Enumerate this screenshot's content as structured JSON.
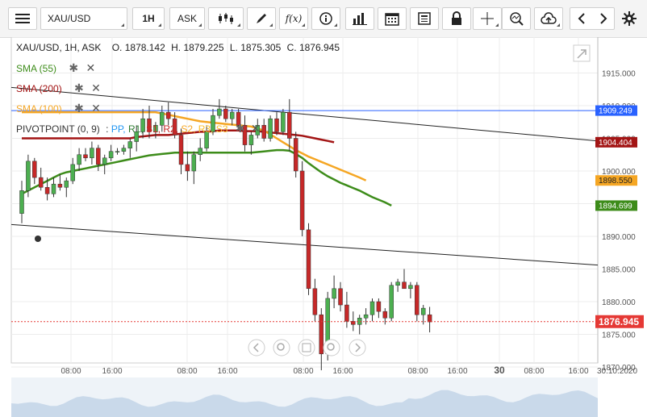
{
  "toolbar": {
    "symbol": "XAU/USD",
    "interval": "1H",
    "price_type": "ASK",
    "icons": [
      "menu-icon",
      "candlestick-type-icon",
      "draw-pen-icon",
      "function-icon",
      "info-icon",
      "volume-bars-icon",
      "calendar-icon",
      "news-icon",
      "lock-icon",
      "crosshair-icon",
      "zoom-icon",
      "cloud-upload-icon",
      "back-arrow-icon",
      "forward-arrow-icon",
      "settings-gear-icon"
    ]
  },
  "header": {
    "instrument": "XAU/USD, 1H, ASK",
    "open": "O. 1878.142",
    "high": "H. 1879.225",
    "low": "L. 1875.305",
    "close": "C. 1876.945"
  },
  "indicators": {
    "sma55": "SMA (55)",
    "sma200": "SMA (200)",
    "sma100": "SMA (100)",
    "pivot_name": "PIVOTPOINT (0, 9)",
    "pivot_sep": ":",
    "pivot_levels": [
      "PP,",
      "R1,",
      "S1,",
      "R2,",
      "S2,",
      "R3,",
      "S3"
    ]
  },
  "colors": {
    "up": "#4caf50",
    "down": "#c62828",
    "sma55": "#3d8c1a",
    "sma200": "#a31515",
    "sma100": "#f5a623",
    "current_price": "#e53935",
    "hline": "#2962ff"
  },
  "chart_data": {
    "type": "candlestick",
    "y_axis": {
      "ylim": [
        1866.0,
        1915.5
      ],
      "ticks": [
        "1915.000",
        "1910.000",
        "1905.000",
        "1900.000",
        "1895.000",
        "1890.000",
        "1885.000",
        "1880.000",
        "1875.000",
        "1870.000"
      ]
    },
    "x_axis": {
      "ticks": [
        "08:00",
        "16:00",
        "08:00",
        "16:00",
        "08:00",
        "16:00",
        "08:00",
        "16:00",
        "30",
        "08:00",
        "16:00",
        "30.10.2020"
      ]
    },
    "price_labels": [
      {
        "name": "horizontal-line",
        "value": "1909.249"
      },
      {
        "name": "sma200",
        "value": "1904.404"
      },
      {
        "name": "sma100",
        "value": "1898.550"
      },
      {
        "name": "sma55",
        "value": "1894.699"
      },
      {
        "name": "current",
        "value": "1876.945"
      }
    ],
    "candles": [
      [
        1893.5,
        1898.5,
        1892.0,
        1897.0
      ],
      [
        1897.0,
        1902.5,
        1896.0,
        1901.5
      ],
      [
        1901.5,
        1902.0,
        1898.0,
        1899.0
      ],
      [
        1899.0,
        1900.5,
        1897.0,
        1897.5
      ],
      [
        1897.5,
        1899.0,
        1895.5,
        1896.5
      ],
      [
        1896.5,
        1899.0,
        1896.0,
        1898.0
      ],
      [
        1898.0,
        1899.5,
        1897.0,
        1897.5
      ],
      [
        1897.5,
        1899.0,
        1896.0,
        1898.5
      ],
      [
        1898.5,
        1902.0,
        1898.0,
        1901.0
      ],
      [
        1901.0,
        1903.5,
        1900.0,
        1902.5
      ],
      [
        1902.5,
        1903.5,
        1901.5,
        1902.0
      ],
      [
        1902.0,
        1904.5,
        1901.0,
        1903.5
      ],
      [
        1903.5,
        1904.0,
        1900.0,
        1901.0
      ],
      [
        1901.0,
        1902.5,
        1899.5,
        1902.0
      ],
      [
        1902.0,
        1904.0,
        1901.5,
        1903.0
      ],
      [
        1903.0,
        1903.5,
        1902.5,
        1903.0
      ],
      [
        1903.0,
        1904.0,
        1902.5,
        1903.5
      ],
      [
        1903.5,
        1905.0,
        1902.0,
        1904.5
      ],
      [
        1904.5,
        1907.0,
        1903.0,
        1906.0
      ],
      [
        1906.0,
        1909.5,
        1905.0,
        1908.0
      ],
      [
        1908.0,
        1910.0,
        1905.0,
        1906.0
      ],
      [
        1906.0,
        1907.5,
        1905.0,
        1907.0
      ],
      [
        1907.0,
        1910.0,
        1906.0,
        1909.0
      ],
      [
        1909.0,
        1910.5,
        1907.0,
        1908.0
      ],
      [
        1908.0,
        1909.0,
        1905.0,
        1905.5
      ],
      [
        1905.5,
        1906.5,
        1899.5,
        1901.0
      ],
      [
        1901.0,
        1903.0,
        1898.5,
        1900.0
      ],
      [
        1900.0,
        1903.0,
        1898.0,
        1902.5
      ],
      [
        1902.5,
        1905.0,
        1901.5,
        1903.5
      ],
      [
        1903.5,
        1907.0,
        1903.0,
        1906.0
      ],
      [
        1906.0,
        1909.5,
        1905.5,
        1908.5
      ],
      [
        1908.5,
        1911.0,
        1908.0,
        1909.5
      ],
      [
        1909.5,
        1910.0,
        1907.5,
        1908.0
      ],
      [
        1908.0,
        1909.5,
        1907.0,
        1909.0
      ],
      [
        1909.0,
        1909.5,
        1906.5,
        1907.0
      ],
      [
        1907.0,
        1908.5,
        1903.0,
        1904.0
      ],
      [
        1904.0,
        1906.0,
        1902.5,
        1905.5
      ],
      [
        1905.5,
        1908.0,
        1905.0,
        1907.0
      ],
      [
        1907.0,
        1908.0,
        1904.5,
        1905.0
      ],
      [
        1905.0,
        1908.5,
        1904.5,
        1908.0
      ],
      [
        1908.0,
        1909.0,
        1905.5,
        1906.0
      ],
      [
        1906.0,
        1909.5,
        1905.5,
        1909.0
      ],
      [
        1909.0,
        1911.0,
        1903.0,
        1905.0
      ],
      [
        1905.0,
        1906.0,
        1899.0,
        1900.0
      ],
      [
        1900.0,
        1901.5,
        1890.0,
        1891.0
      ],
      [
        1891.0,
        1892.0,
        1881.0,
        1882.0
      ],
      [
        1882.0,
        1883.5,
        1877.0,
        1878.0
      ],
      [
        1878.0,
        1879.0,
        1869.5,
        1872.0
      ],
      [
        1872.0,
        1881.5,
        1871.0,
        1880.5
      ],
      [
        1880.5,
        1884.0,
        1879.0,
        1882.0
      ],
      [
        1882.0,
        1883.0,
        1878.5,
        1879.5
      ],
      [
        1879.5,
        1881.5,
        1876.0,
        1877.0
      ],
      [
        1877.0,
        1878.5,
        1875.5,
        1876.5
      ],
      [
        1876.5,
        1878.0,
        1875.0,
        1877.5
      ],
      [
        1877.5,
        1879.0,
        1876.5,
        1878.0
      ],
      [
        1878.0,
        1880.5,
        1877.0,
        1880.0
      ],
      [
        1880.0,
        1880.5,
        1877.5,
        1878.5
      ],
      [
        1878.5,
        1879.0,
        1876.5,
        1877.5
      ],
      [
        1877.5,
        1883.0,
        1877.0,
        1882.5
      ],
      [
        1882.5,
        1883.5,
        1881.5,
        1883.0
      ],
      [
        1883.0,
        1885.0,
        1882.0,
        1882.0
      ],
      [
        1882.0,
        1883.0,
        1880.5,
        1882.5
      ],
      [
        1882.5,
        1883.0,
        1877.0,
        1878.0
      ],
      [
        1878.0,
        1879.5,
        1876.5,
        1879.0
      ],
      [
        1878.0,
        1879.2,
        1875.3,
        1876.9
      ]
    ],
    "sma55": [
      1896.5,
      1897.0,
      1897.5,
      1898.0,
      1898.5,
      1899.0,
      1899.5,
      1899.8,
      1900.0,
      1900.2,
      1900.4,
      1900.6,
      1900.8,
      1901.0,
      1901.2,
      1901.4,
      1901.6,
      1901.8,
      1902.0,
      1902.2,
      1902.4,
      1902.5,
      1902.6,
      1902.7,
      1902.8,
      1902.8,
      1902.8,
      1902.8,
      1902.8,
      1902.8,
      1902.8,
      1902.8,
      1902.8,
      1902.8,
      1902.8,
      1902.8,
      1902.8,
      1902.9,
      1903.0,
      1903.1,
      1903.2,
      1903.2,
      1903.1,
      1902.6,
      1902.0,
      1901.2,
      1900.5,
      1899.8,
      1899.2,
      1898.7,
      1898.2,
      1897.8,
      1897.4,
      1897.0,
      1896.5,
      1896.0,
      1895.6,
      1895.2,
      1894.7
    ],
    "sma100": [
      1909.0,
      1909.0,
      1909.0,
      1909.0,
      1909.0,
      1909.0,
      1909.0,
      1909.0,
      1909.0,
      1909.0,
      1909.0,
      1909.0,
      1909.0,
      1909.0,
      1909.0,
      1909.0,
      1909.0,
      1909.0,
      1909.0,
      1909.0,
      1909.0,
      1909.0,
      1908.8,
      1908.6,
      1908.4,
      1908.2,
      1908.0,
      1907.8,
      1907.6,
      1907.5,
      1907.4,
      1907.3,
      1907.2,
      1907.1,
      1907.0,
      1906.9,
      1906.8,
      1906.5,
      1906.2,
      1905.6,
      1905.0,
      1904.4,
      1903.8,
      1903.2,
      1902.7,
      1902.2,
      1901.8,
      1901.4,
      1901.0,
      1900.6,
      1900.2,
      1899.8,
      1899.4,
      1899.0,
      1898.55
    ],
    "sma200": [
      1905.0,
      1905.0,
      1905.0,
      1905.0,
      1905.0,
      1905.0,
      1905.0,
      1905.0,
      1905.0,
      1905.0,
      1905.0,
      1905.0,
      1905.0,
      1905.0,
      1905.0,
      1905.0,
      1905.0,
      1905.0,
      1905.2,
      1905.3,
      1905.4,
      1905.5,
      1905.5,
      1905.5,
      1905.6,
      1905.7,
      1905.8,
      1905.9,
      1906.0,
      1906.0,
      1906.1,
      1906.2,
      1906.2,
      1906.2,
      1906.2,
      1906.1,
      1906.1,
      1906.1,
      1906.0,
      1905.9,
      1905.8,
      1905.7,
      1905.6,
      1905.5,
      1905.4,
      1905.2,
      1905.0,
      1904.8,
      1904.6,
      1904.4
    ],
    "horizontal_line": 1909.249,
    "trend_lines": [
      {
        "from": [
          0,
          1912.8
        ],
        "to": [
          1,
          1904.6
        ]
      },
      {
        "from": [
          0,
          1891.8
        ],
        "to": [
          1,
          1885.6
        ]
      }
    ],
    "current_price": 1876.945
  }
}
